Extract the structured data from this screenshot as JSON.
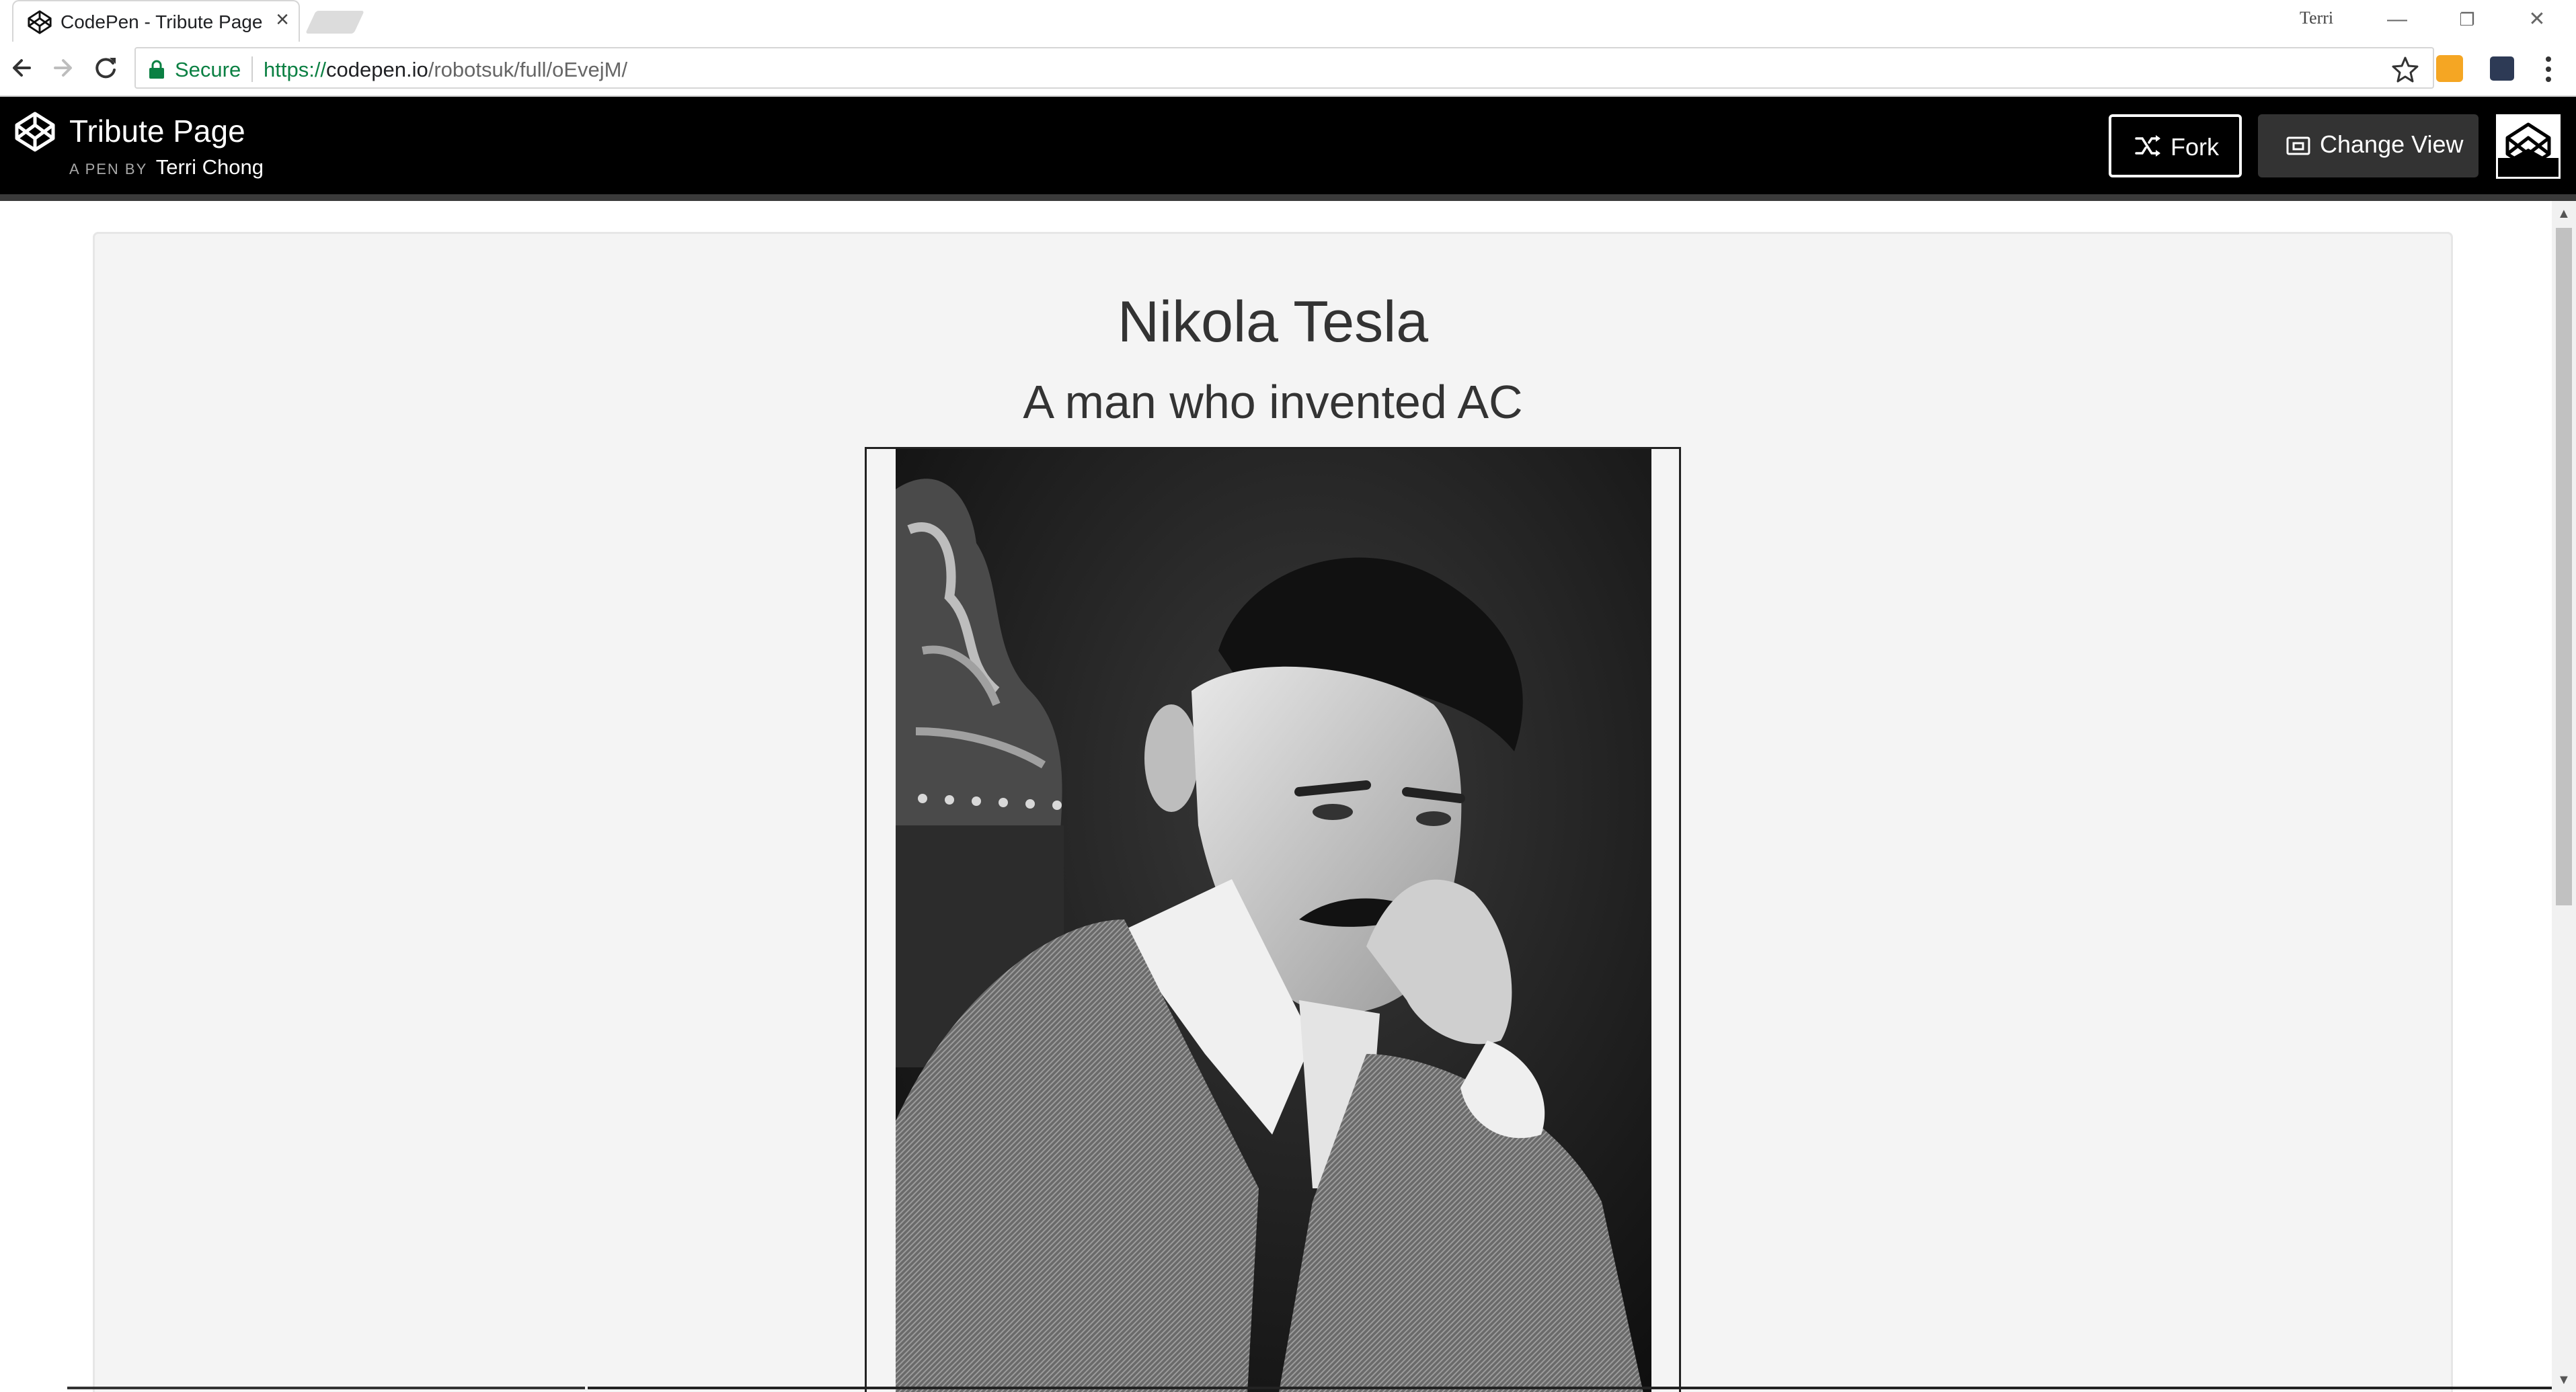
{
  "browser": {
    "tab_title": "CodePen - Tribute Page",
    "tab_close": "×",
    "profile_name": "Terri",
    "window_controls": {
      "minimize": "—",
      "restore": "❐",
      "close": "✕"
    },
    "address": {
      "secure_label": "Secure",
      "url_scheme": "https://",
      "url_host": "codepen.io",
      "url_path": "/robotsuk/full/oEvejM/"
    },
    "extensions": [
      "rss-feed-icon",
      "extension-icon"
    ]
  },
  "codepen": {
    "pen_title": "Tribute Page",
    "byline_prefix": "A PEN BY",
    "author": "Terri Chong",
    "fork_label": "Fork",
    "change_view_label": "Change View"
  },
  "page": {
    "heading": "Nikola Tesla",
    "subheading": "A man who invented AC"
  },
  "colors": {
    "codepen_header": "#000000",
    "page_background": "#f4f4f4",
    "secure_green": "#0b8043"
  }
}
